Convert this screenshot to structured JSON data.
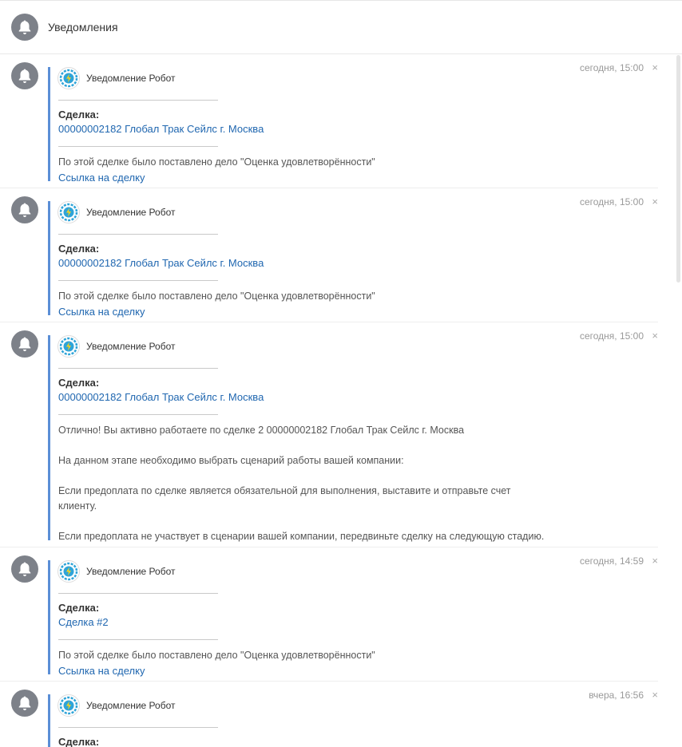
{
  "header": {
    "title": "Уведомления"
  },
  "notifications": [
    {
      "author": "Уведомление Робот",
      "time": "сегодня, 15:00",
      "deal_label": "Сделка:",
      "deal_link": "00000002182 Глобал Трак Сейлс г. Москва",
      "text": "По этой сделке было поставлено дело \"Оценка удовлетворённости\"",
      "link": "Ссылка на сделку"
    },
    {
      "author": "Уведомление Робот",
      "time": "сегодня, 15:00",
      "deal_label": "Сделка:",
      "deal_link": "00000002182 Глобал Трак Сейлс г. Москва",
      "text": "По этой сделке было поставлено дело \"Оценка удовлетворённости\"",
      "link": "Ссылка на сделку"
    },
    {
      "author": "Уведомление Робот",
      "time": "сегодня, 15:00",
      "deal_label": "Сделка:",
      "deal_link": "00000002182 Глобал Трак Сейлс г. Москва",
      "paragraphs": [
        "Отлично! Вы активно работаете по сделке 2 00000002182 Глобал Трак Сейлс  г. Москва",
        "На данном этапе необходимо выбрать сценарий работы вашей компании:",
        "Если предоплата по сделке является обязательной для выполнения, выставите и отправьте счет клиенту.",
        "Если предоплата не участвует в сценарии вашей компании, передвиньте сделку на следующую стадию."
      ]
    },
    {
      "author": "Уведомление Робот",
      "time": "сегодня, 14:59",
      "deal_label": "Сделка:",
      "deal_link": "Сделка #2",
      "text": "По этой сделке было поставлено дело \"Оценка удовлетворённости\"",
      "link": "Ссылка на сделку"
    },
    {
      "author": "Уведомление Робот",
      "time": "вчера, 16:56",
      "deal_label": "Сделка:"
    }
  ],
  "close_symbol": "×",
  "colors": {
    "accent_bar": "#5b8fd6",
    "link": "#2067b0",
    "bell_bg": "#7d8189"
  },
  "icons": {
    "bell": "bell-icon",
    "robot": "robot-avatar-icon",
    "close": "close-icon"
  }
}
